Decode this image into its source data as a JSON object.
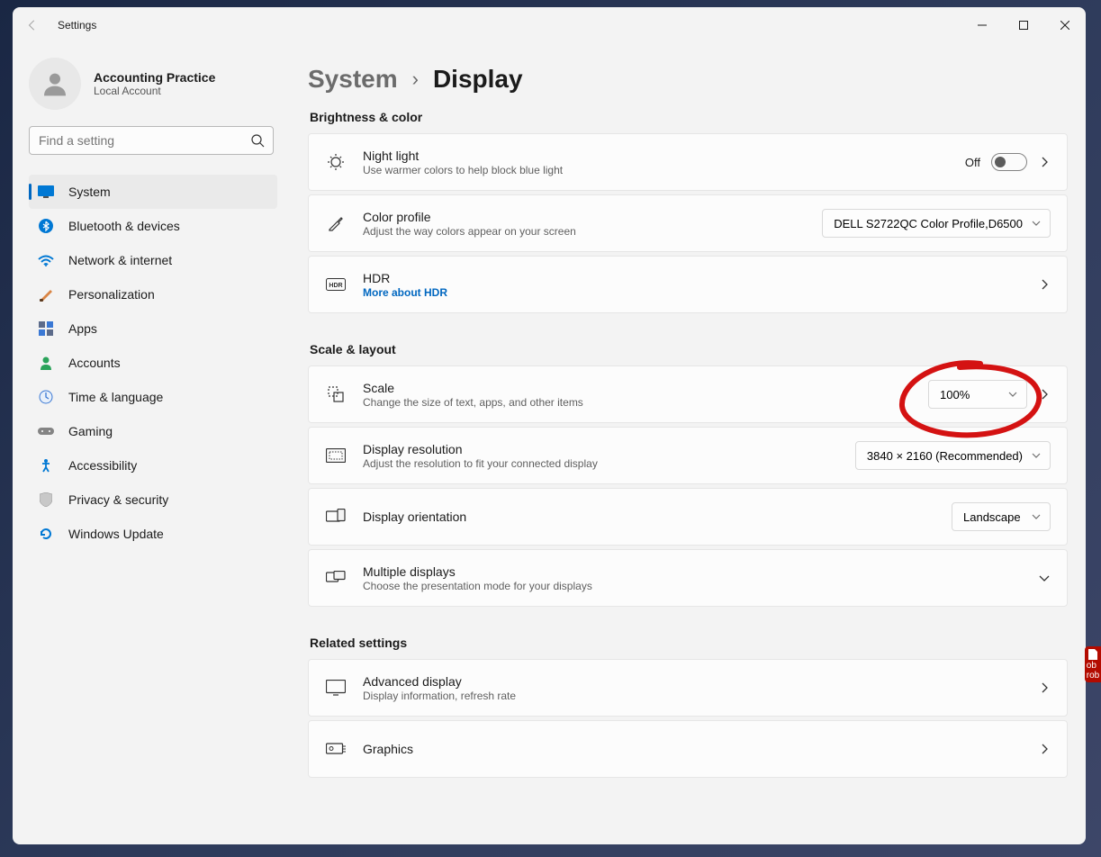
{
  "app_title": "Settings",
  "profile": {
    "name": "Accounting Practice",
    "sub": "Local Account"
  },
  "search": {
    "placeholder": "Find a setting"
  },
  "nav": [
    {
      "label": "System"
    },
    {
      "label": "Bluetooth & devices"
    },
    {
      "label": "Network & internet"
    },
    {
      "label": "Personalization"
    },
    {
      "label": "Apps"
    },
    {
      "label": "Accounts"
    },
    {
      "label": "Time & language"
    },
    {
      "label": "Gaming"
    },
    {
      "label": "Accessibility"
    },
    {
      "label": "Privacy & security"
    },
    {
      "label": "Windows Update"
    }
  ],
  "breadcrumb": {
    "parent": "System",
    "current": "Display"
  },
  "sections": {
    "brightness": {
      "title": "Brightness & color",
      "night_light": {
        "title": "Night light",
        "sub": "Use warmer colors to help block blue light",
        "toggle_label": "Off"
      },
      "color_profile": {
        "title": "Color profile",
        "sub": "Adjust the way colors appear on your screen",
        "value": "DELL S2722QC Color Profile,D6500"
      },
      "hdr": {
        "title": "HDR",
        "link": "More about HDR"
      }
    },
    "scale": {
      "title": "Scale & layout",
      "scale": {
        "title": "Scale",
        "sub": "Change the size of text, apps, and other items",
        "value": "100%"
      },
      "resolution": {
        "title": "Display resolution",
        "sub": "Adjust the resolution to fit your connected display",
        "value": "3840 × 2160 (Recommended)"
      },
      "orientation": {
        "title": "Display orientation",
        "value": "Landscape"
      },
      "multiple": {
        "title": "Multiple displays",
        "sub": "Choose the presentation mode for your displays"
      }
    },
    "related": {
      "title": "Related settings",
      "advanced": {
        "title": "Advanced display",
        "sub": "Display information, refresh rate"
      },
      "graphics": {
        "title": "Graphics"
      }
    }
  },
  "desktop_icon": {
    "line1": "ob",
    "line2": "rob"
  }
}
